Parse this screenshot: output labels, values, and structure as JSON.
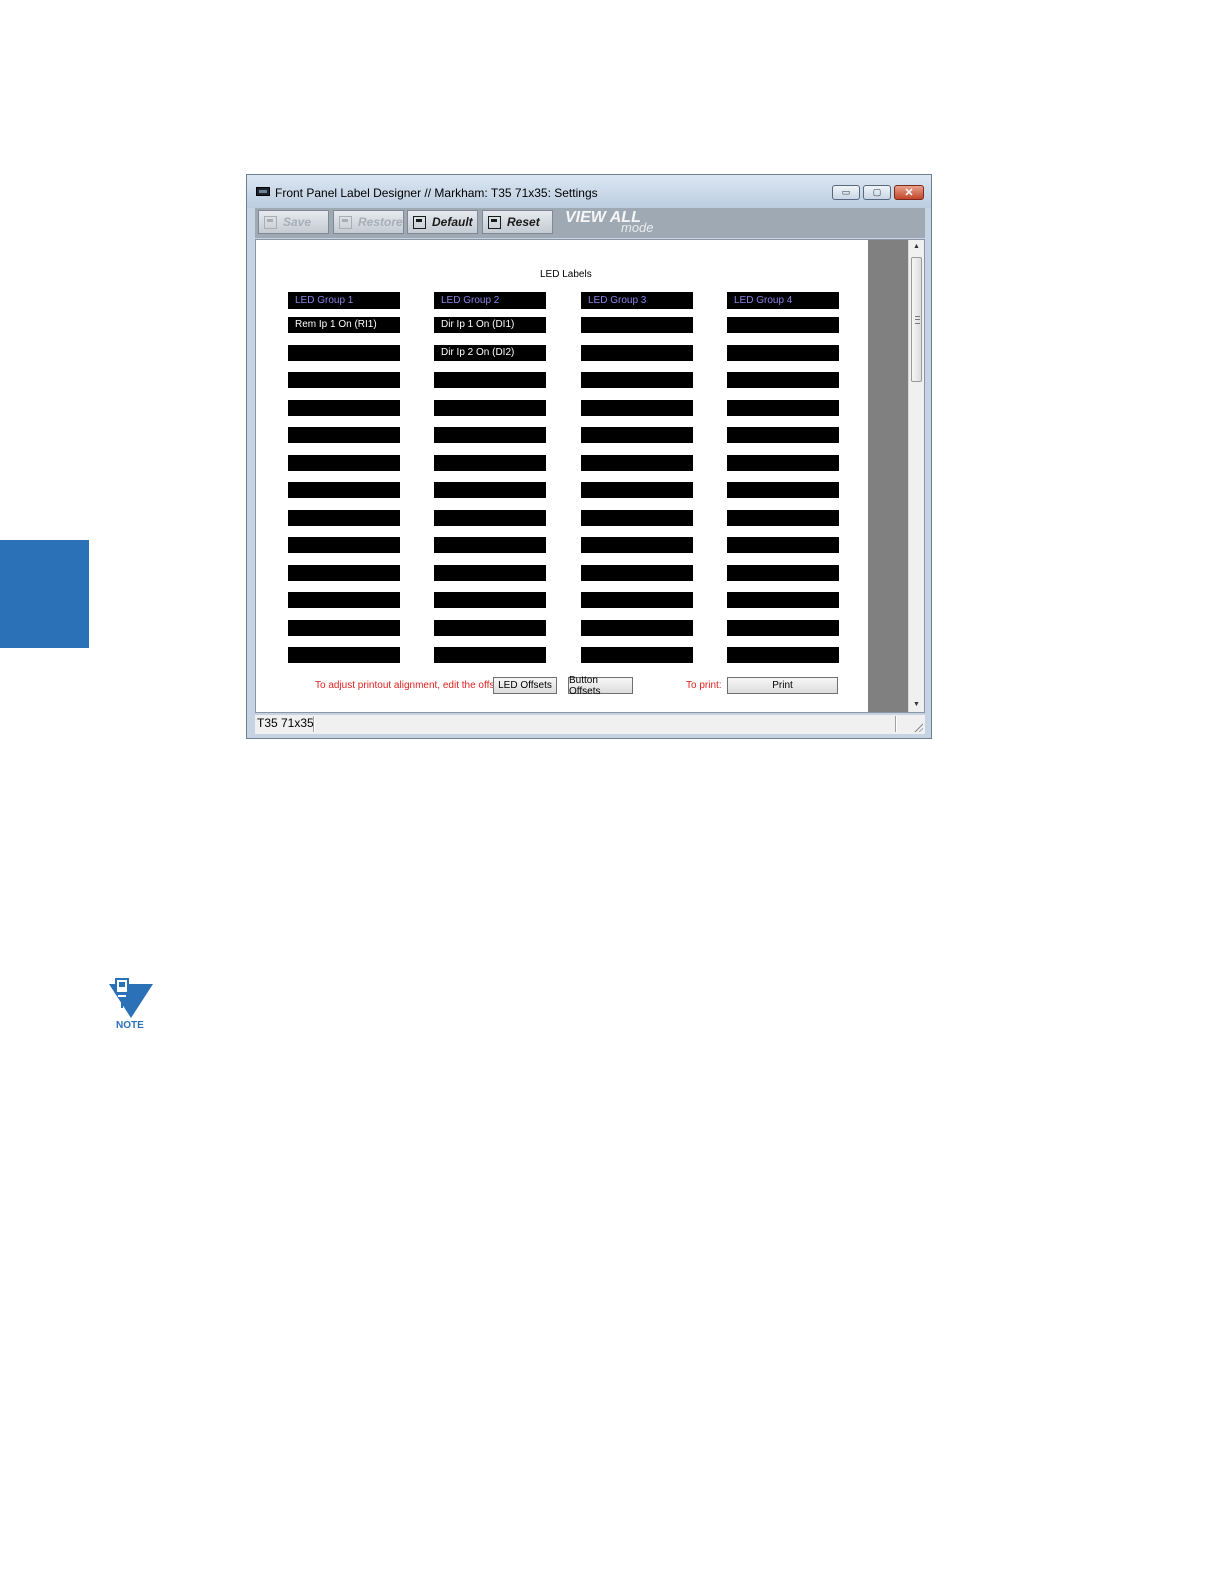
{
  "window": {
    "title": "Front Panel Label Designer // Markham: T35 71x35: Settings",
    "controls": {
      "minimize": "▭",
      "maximize": "▢",
      "close": "✕"
    }
  },
  "toolbar": {
    "save_label": "Save",
    "restore_label": "Restore",
    "default_label": "Default",
    "reset_label": "Reset",
    "view_all_label": "VIEW ALL",
    "mode_label": "mode"
  },
  "led_section": {
    "heading": "LED Labels",
    "groups": [
      {
        "name": "LED Group 1",
        "slots": [
          "Rem Ip 1 On (RI1)",
          "",
          "",
          "",
          "",
          "",
          "",
          "",
          "",
          "",
          "",
          "",
          ""
        ]
      },
      {
        "name": "LED Group 2",
        "slots": [
          "Dir Ip 1 On (DI1)",
          "Dir Ip 2 On (DI2)",
          "",
          "",
          "",
          "",
          "",
          "",
          "",
          "",
          "",
          "",
          ""
        ]
      },
      {
        "name": "LED Group 3",
        "slots": [
          "",
          "",
          "",
          "",
          "",
          "",
          "",
          "",
          "",
          "",
          "",
          "",
          ""
        ]
      },
      {
        "name": "LED Group 4",
        "slots": [
          "",
          "",
          "",
          "",
          "",
          "",
          "",
          "",
          "",
          "",
          "",
          "",
          ""
        ]
      }
    ]
  },
  "footer": {
    "alignment_text": "To adjust printout alignment, edit the offsets:",
    "led_offsets_label": "LED Offsets",
    "button_offsets_label": "Button Offsets",
    "print_prompt": "To print:",
    "print_label": "Print"
  },
  "status_bar": {
    "device": "T35 71x35"
  },
  "note": {
    "label": "NOTE"
  },
  "colors": {
    "accent_blue": "#2a71b8",
    "group_header_text": "#8b83e8",
    "instruction_red": "#e02020"
  }
}
